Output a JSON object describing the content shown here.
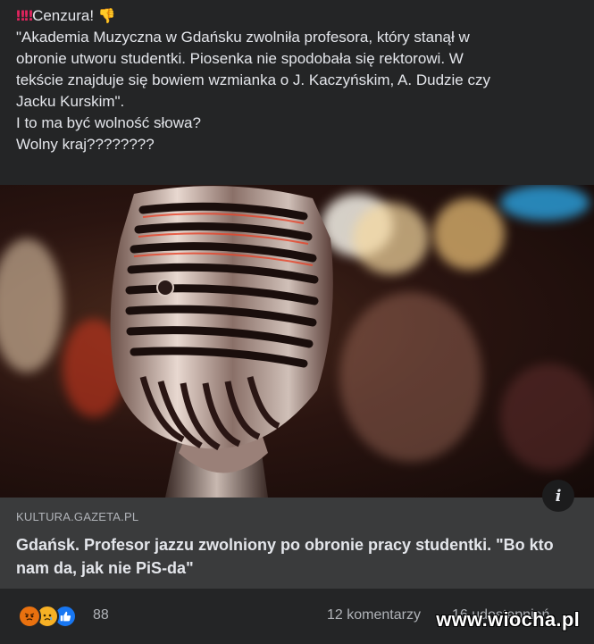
{
  "post": {
    "lines": [
      "\"Akademia Muzyczna w Gdańsku zwolniła profesora, który stanął w",
      "obronie utworu studentki. Piosenka nie spodobała się rektorowi. W",
      "tekście znajduje się bowiem wzmianka o J. Kaczyńskim, A. Dudzie czy",
      "Jacku Kurskim\".",
      "I to ma być wolność słowa?",
      "Wolny kraj????????"
    ],
    "first_line": {
      "bangs": "‼‼",
      "text": "Cenzura!",
      "thumb": "👎"
    }
  },
  "link": {
    "domain": "KULTURA.GAZETA.PL",
    "title": "Gdańsk. Profesor jazzu zwolniony po obronie pracy studentki. \"Bo kto nam da, jak nie PiS-da\"",
    "info_icon": "i"
  },
  "footer": {
    "reaction_count": "88",
    "comments": "12 komentarzy",
    "shares": "16 udostępnień",
    "reactions": [
      "angry-icon",
      "sad-icon",
      "like-icon"
    ]
  },
  "watermark": "www.wiocha.pl",
  "colors": {
    "background": "#242526",
    "card": "#3a3b3c",
    "text": "#e4e6eb",
    "muted": "#b0b3b8",
    "like": "#1877f2",
    "angry": "#e9710f"
  }
}
